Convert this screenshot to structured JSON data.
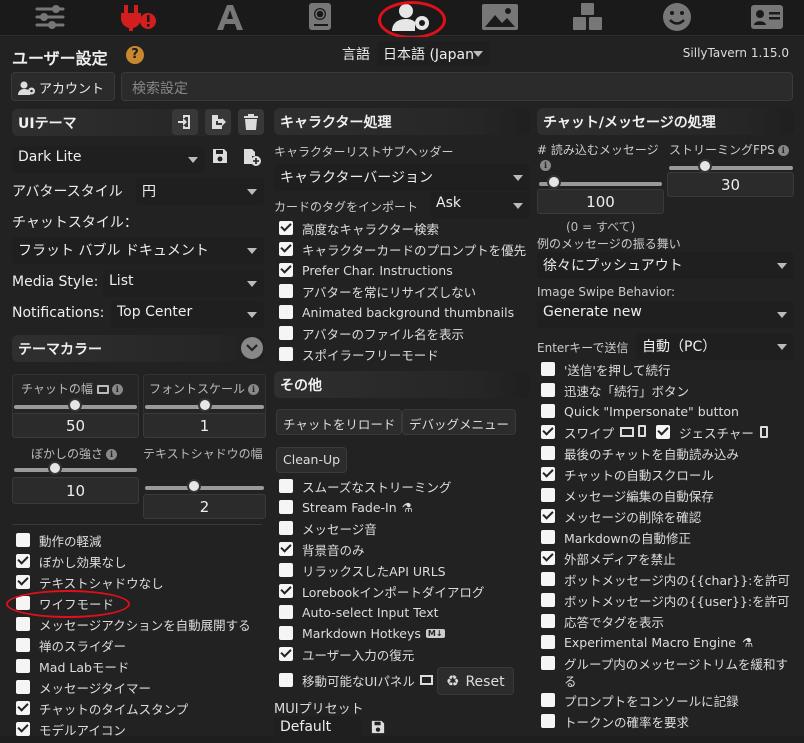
{
  "topbar": {
    "icons": [
      "sliders-icon",
      "plug-warning-icon",
      "font-icon",
      "book-globe-icon",
      "user-gear-icon",
      "image-icon",
      "cubes-icon",
      "smile-icon",
      "id-card-icon"
    ]
  },
  "header": {
    "title": "ユーザー設定",
    "help": "?",
    "lang_label": "言語",
    "lang_value": "日本語 (Japan",
    "version": "SillyTavern 1.15.0"
  },
  "account": {
    "button": "アカウント",
    "search_placeholder": "検索設定"
  },
  "col1": {
    "theme_title": "UIテーマ",
    "theme_value": "Dark Lite",
    "avatar_style_label": "アバタースタイル",
    "avatar_style_value": "円",
    "chat_style_label": "チャットスタイル：",
    "chat_style_value": "フラット バブル ドキュメント",
    "media_style_label": "Media Style:",
    "media_style_value": "List",
    "notifications_label": "Notifications:",
    "notifications_value": "Top Center",
    "theme_colors": "テーマカラー",
    "chat_width_label": "チャットの幅",
    "chat_width_value": "50",
    "font_scale_label": "フォントスケール",
    "font_scale_value": "1",
    "blur_label": "ぼかしの強さ",
    "blur_value": "10",
    "shadow_label": "テキストシャドウの幅",
    "shadow_value": "2",
    "checks": [
      {
        "label": "動作の軽減",
        "on": false
      },
      {
        "label": "ぼかし効果なし",
        "on": true
      },
      {
        "label": "テキストシャドウなし",
        "on": true
      },
      {
        "label": "ワイフモード",
        "on": false
      },
      {
        "label": "メッセージアクションを自動展開する",
        "on": false
      },
      {
        "label": "禅のスライダー",
        "on": false
      },
      {
        "label": "Mad Labモード",
        "on": false
      },
      {
        "label": "メッセージタイマー",
        "on": false
      },
      {
        "label": "チャットのタイムスタンプ",
        "on": true
      },
      {
        "label": "モデルアイコン",
        "on": true
      }
    ]
  },
  "col2": {
    "char_title": "キャラクター処理",
    "subheader_label": "キャラクターリストサブヘッダー",
    "subheader_value": "キャラクターバージョン",
    "import_tags_label": "カードのタグをインポート",
    "import_tags_value": "Ask",
    "checks": [
      {
        "label": "高度なキャラクター検索",
        "on": true
      },
      {
        "label": "キャラクターカードのプロンプトを優先",
        "on": true
      },
      {
        "label": "Prefer Char. Instructions",
        "on": true
      },
      {
        "label": "アバターを常にリサイズしない",
        "on": false
      },
      {
        "label": "Animated background thumbnails",
        "on": false
      },
      {
        "label": "アバターのファイル名を表示",
        "on": false
      },
      {
        "label": "スポイラーフリーモード",
        "on": false
      }
    ],
    "misc_title": "その他",
    "reload_btn": "チャットをリロード",
    "debug_btn": "デバッグメニュー",
    "cleanup_btn": "Clean-Up",
    "checks2": [
      {
        "label": "スムーズなストリーミング",
        "on": false
      },
      {
        "label": "Stream Fade-In",
        "on": false
      },
      {
        "label": "メッセージ音",
        "on": false
      },
      {
        "label": "背景音のみ",
        "on": true
      },
      {
        "label": "リラックスしたAPI URLS",
        "on": false
      },
      {
        "label": "Lorebookインポートダイアログ",
        "on": true
      },
      {
        "label": "Auto-select Input Text",
        "on": false
      },
      {
        "label": "Markdown Hotkeys",
        "on": false
      },
      {
        "label": "ユーザー入力の復元",
        "on": true
      },
      {
        "label": "移動可能なUIパネル",
        "on": false
      }
    ],
    "reset_btn": "Reset",
    "mui_label": "MUIプリセット",
    "mui_value": "Default"
  },
  "col3": {
    "chat_title": "チャット/メッセージの処理",
    "load_label": "# 読み込むメッセージ",
    "load_value": "100",
    "load_hint": "(0 = すべて)",
    "fps_label": "ストリーミングFPS",
    "fps_value": "30",
    "example_label": "例のメッセージの振る舞い",
    "example_value": "徐々にプッシュアウト",
    "swipe_label": "Image Swipe Behavior:",
    "swipe_value": "Generate new",
    "enter_label": "Enterキーで送信",
    "enter_value": "自動（PC）",
    "checks": [
      {
        "label": "'送信'を押して続行",
        "on": false
      },
      {
        "label": "迅速な「続行」ボタン",
        "on": false
      },
      {
        "label": "Quick \"Impersonate\" button",
        "on": false
      },
      {
        "label": "スワイプ",
        "on": true
      },
      {
        "label": "最後のチャットを自動読み込み",
        "on": false
      },
      {
        "label": "チャットの自動スクロール",
        "on": true
      },
      {
        "label": "メッセージ編集の自動保存",
        "on": false
      },
      {
        "label": "メッセージの削除を確認",
        "on": true
      },
      {
        "label": "Markdownの自動修正",
        "on": false
      },
      {
        "label": "外部メディアを禁止",
        "on": true
      },
      {
        "label": "ボットメッセージ内の{{char}}:を許可",
        "on": false
      },
      {
        "label": "ボットメッセージ内の{{user}}:を許可",
        "on": false
      },
      {
        "label": "応答でタグを表示",
        "on": false
      },
      {
        "label": "Experimental Macro Engine",
        "on": false
      },
      {
        "label": "グループ内のメッセージトリムを緩和す",
        "on": false
      },
      {
        "label": "プロンプトをコンソールに記録",
        "on": false
      },
      {
        "label": "トークンの確率を要求",
        "on": false
      }
    ],
    "gesture_label": "ジェスチャー",
    "gesture_on": true,
    "wrap_char": "る"
  }
}
